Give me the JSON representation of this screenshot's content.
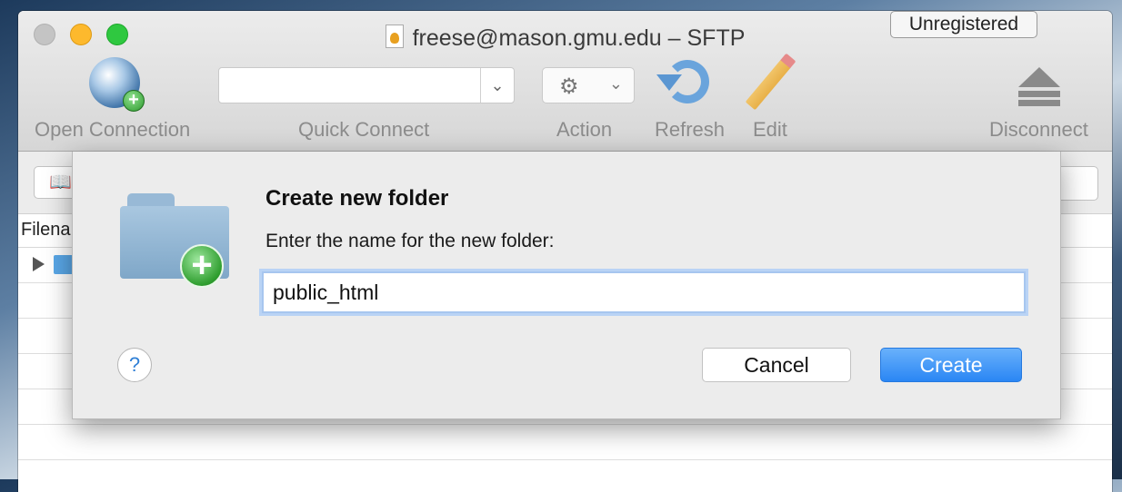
{
  "window": {
    "title": "freese@mason.gmu.edu – SFTP",
    "unregistered_label": "Unregistered"
  },
  "toolbar": {
    "open_connection": "Open Connection",
    "quick_connect": "Quick Connect",
    "quick_connect_value": "",
    "action": "Action",
    "refresh": "Refresh",
    "edit": "Edit",
    "disconnect": "Disconnect"
  },
  "browser": {
    "column_filename": "Filena"
  },
  "dialog": {
    "title": "Create new folder",
    "message": "Enter the name for the new folder:",
    "folder_name_value": "public_html",
    "help_label": "?",
    "cancel_label": "Cancel",
    "create_label": "Create"
  },
  "colors": {
    "accent": "#2a86f4",
    "focus_ring": "#a7c6ef"
  },
  "icons": {
    "open_connection": "globe-plus-icon",
    "action": "gear-icon",
    "refresh": "refresh-icon",
    "edit": "pencil-icon",
    "disconnect": "eject-icon",
    "dialog": "folder-plus-icon"
  }
}
